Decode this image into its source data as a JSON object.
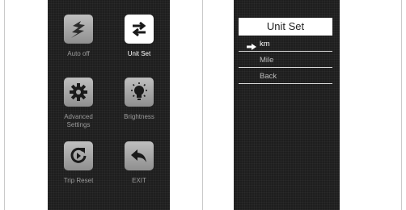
{
  "menu": {
    "tiles": [
      {
        "label": "Auto off",
        "icon": "lightning-icon"
      },
      {
        "label": "Unit Set",
        "icon": "swap-arrows-icon",
        "active": true
      },
      {
        "label": "Advanced\nSettings",
        "icon": "gear-icon"
      },
      {
        "label": "Brightness",
        "icon": "lightbulb-icon"
      },
      {
        "label": "Trip Reset",
        "icon": "reset-icon"
      },
      {
        "label": "EXIT",
        "icon": "back-arrow-icon"
      }
    ]
  },
  "unit_set": {
    "title": "Unit Set",
    "options": [
      {
        "label": "km",
        "selected": true
      },
      {
        "label": "Mile",
        "selected": false
      },
      {
        "label": "Back",
        "selected": false
      }
    ]
  },
  "colors": {
    "screen_bg": "#1e1e1e",
    "active_tile": "#ffffff",
    "inactive_tile": "#a8a8a8"
  }
}
